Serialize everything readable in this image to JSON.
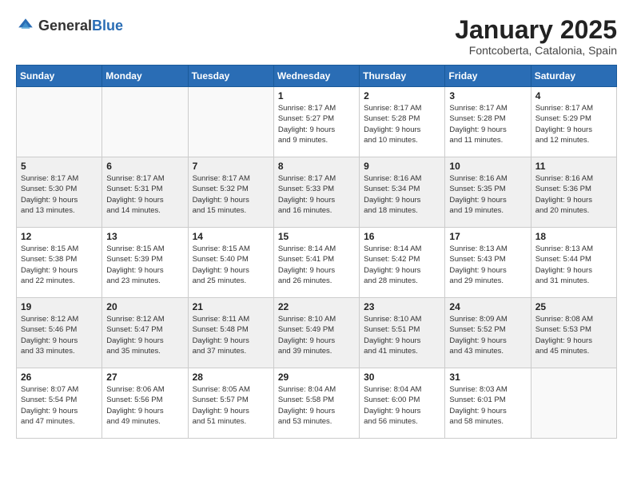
{
  "header": {
    "logo_general": "General",
    "logo_blue": "Blue",
    "month_title": "January 2025",
    "location": "Fontcoberta, Catalonia, Spain"
  },
  "weekdays": [
    "Sunday",
    "Monday",
    "Tuesday",
    "Wednesday",
    "Thursday",
    "Friday",
    "Saturday"
  ],
  "weeks": [
    {
      "shaded": false,
      "days": [
        {
          "number": "",
          "info": ""
        },
        {
          "number": "",
          "info": ""
        },
        {
          "number": "",
          "info": ""
        },
        {
          "number": "1",
          "info": "Sunrise: 8:17 AM\nSunset: 5:27 PM\nDaylight: 9 hours\nand 9 minutes."
        },
        {
          "number": "2",
          "info": "Sunrise: 8:17 AM\nSunset: 5:28 PM\nDaylight: 9 hours\nand 10 minutes."
        },
        {
          "number": "3",
          "info": "Sunrise: 8:17 AM\nSunset: 5:28 PM\nDaylight: 9 hours\nand 11 minutes."
        },
        {
          "number": "4",
          "info": "Sunrise: 8:17 AM\nSunset: 5:29 PM\nDaylight: 9 hours\nand 12 minutes."
        }
      ]
    },
    {
      "shaded": true,
      "days": [
        {
          "number": "5",
          "info": "Sunrise: 8:17 AM\nSunset: 5:30 PM\nDaylight: 9 hours\nand 13 minutes."
        },
        {
          "number": "6",
          "info": "Sunrise: 8:17 AM\nSunset: 5:31 PM\nDaylight: 9 hours\nand 14 minutes."
        },
        {
          "number": "7",
          "info": "Sunrise: 8:17 AM\nSunset: 5:32 PM\nDaylight: 9 hours\nand 15 minutes."
        },
        {
          "number": "8",
          "info": "Sunrise: 8:17 AM\nSunset: 5:33 PM\nDaylight: 9 hours\nand 16 minutes."
        },
        {
          "number": "9",
          "info": "Sunrise: 8:16 AM\nSunset: 5:34 PM\nDaylight: 9 hours\nand 18 minutes."
        },
        {
          "number": "10",
          "info": "Sunrise: 8:16 AM\nSunset: 5:35 PM\nDaylight: 9 hours\nand 19 minutes."
        },
        {
          "number": "11",
          "info": "Sunrise: 8:16 AM\nSunset: 5:36 PM\nDaylight: 9 hours\nand 20 minutes."
        }
      ]
    },
    {
      "shaded": false,
      "days": [
        {
          "number": "12",
          "info": "Sunrise: 8:15 AM\nSunset: 5:38 PM\nDaylight: 9 hours\nand 22 minutes."
        },
        {
          "number": "13",
          "info": "Sunrise: 8:15 AM\nSunset: 5:39 PM\nDaylight: 9 hours\nand 23 minutes."
        },
        {
          "number": "14",
          "info": "Sunrise: 8:15 AM\nSunset: 5:40 PM\nDaylight: 9 hours\nand 25 minutes."
        },
        {
          "number": "15",
          "info": "Sunrise: 8:14 AM\nSunset: 5:41 PM\nDaylight: 9 hours\nand 26 minutes."
        },
        {
          "number": "16",
          "info": "Sunrise: 8:14 AM\nSunset: 5:42 PM\nDaylight: 9 hours\nand 28 minutes."
        },
        {
          "number": "17",
          "info": "Sunrise: 8:13 AM\nSunset: 5:43 PM\nDaylight: 9 hours\nand 29 minutes."
        },
        {
          "number": "18",
          "info": "Sunrise: 8:13 AM\nSunset: 5:44 PM\nDaylight: 9 hours\nand 31 minutes."
        }
      ]
    },
    {
      "shaded": true,
      "days": [
        {
          "number": "19",
          "info": "Sunrise: 8:12 AM\nSunset: 5:46 PM\nDaylight: 9 hours\nand 33 minutes."
        },
        {
          "number": "20",
          "info": "Sunrise: 8:12 AM\nSunset: 5:47 PM\nDaylight: 9 hours\nand 35 minutes."
        },
        {
          "number": "21",
          "info": "Sunrise: 8:11 AM\nSunset: 5:48 PM\nDaylight: 9 hours\nand 37 minutes."
        },
        {
          "number": "22",
          "info": "Sunrise: 8:10 AM\nSunset: 5:49 PM\nDaylight: 9 hours\nand 39 minutes."
        },
        {
          "number": "23",
          "info": "Sunrise: 8:10 AM\nSunset: 5:51 PM\nDaylight: 9 hours\nand 41 minutes."
        },
        {
          "number": "24",
          "info": "Sunrise: 8:09 AM\nSunset: 5:52 PM\nDaylight: 9 hours\nand 43 minutes."
        },
        {
          "number": "25",
          "info": "Sunrise: 8:08 AM\nSunset: 5:53 PM\nDaylight: 9 hours\nand 45 minutes."
        }
      ]
    },
    {
      "shaded": false,
      "days": [
        {
          "number": "26",
          "info": "Sunrise: 8:07 AM\nSunset: 5:54 PM\nDaylight: 9 hours\nand 47 minutes."
        },
        {
          "number": "27",
          "info": "Sunrise: 8:06 AM\nSunset: 5:56 PM\nDaylight: 9 hours\nand 49 minutes."
        },
        {
          "number": "28",
          "info": "Sunrise: 8:05 AM\nSunset: 5:57 PM\nDaylight: 9 hours\nand 51 minutes."
        },
        {
          "number": "29",
          "info": "Sunrise: 8:04 AM\nSunset: 5:58 PM\nDaylight: 9 hours\nand 53 minutes."
        },
        {
          "number": "30",
          "info": "Sunrise: 8:04 AM\nSunset: 6:00 PM\nDaylight: 9 hours\nand 56 minutes."
        },
        {
          "number": "31",
          "info": "Sunrise: 8:03 AM\nSunset: 6:01 PM\nDaylight: 9 hours\nand 58 minutes."
        },
        {
          "number": "",
          "info": ""
        }
      ]
    }
  ]
}
